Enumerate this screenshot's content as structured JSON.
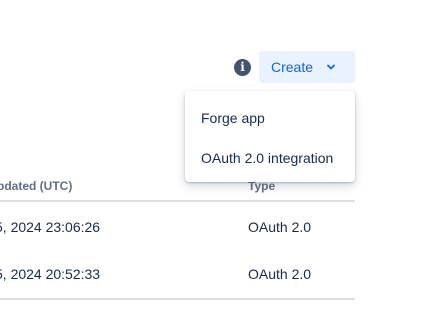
{
  "toolbar": {
    "info_icon": "info-icon",
    "info_glyph": "i",
    "create_label": "Create",
    "create_icon": "chevron-down-icon"
  },
  "create_menu": {
    "items": [
      {
        "label": "Forge app"
      },
      {
        "label": "OAuth 2.0 integration"
      }
    ]
  },
  "table": {
    "columns": [
      "pdated (UTC)",
      "Type"
    ],
    "rows": [
      {
        "updated": "5, 2024 23:06:26",
        "type": "OAuth 2.0"
      },
      {
        "updated": "5, 2024 20:52:33",
        "type": "OAuth 2.0"
      }
    ]
  },
  "colors": {
    "create_bg": "#e9f2ff",
    "create_text": "#0c66e4",
    "header_text": "#626f86",
    "body_text": "#172b4d",
    "divider": "#dcdfe4"
  }
}
